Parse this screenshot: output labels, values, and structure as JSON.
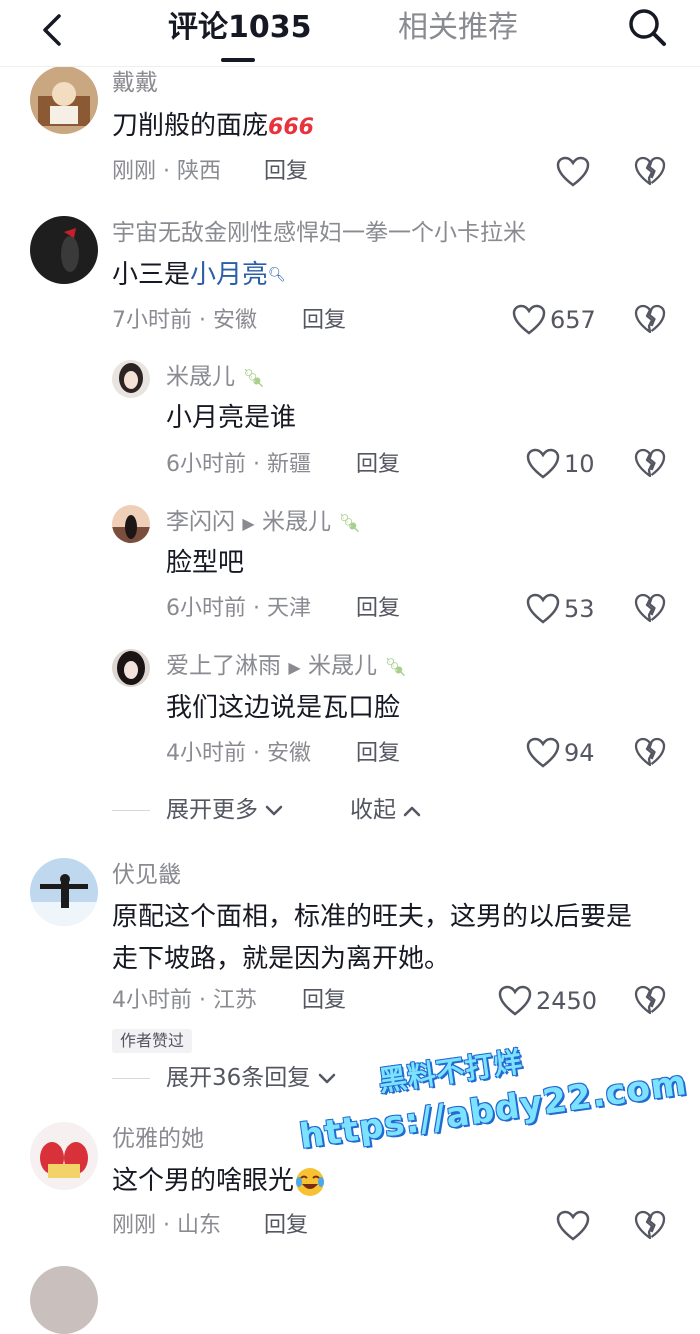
{
  "header": {
    "tab_comments": "评论1035",
    "tab_related": "相关推荐"
  },
  "comments": [
    {
      "username": "戴戴",
      "content": "刀削般的面庞",
      "emoji": "666",
      "time": "刚刚",
      "location": "陕西",
      "reply": "回复",
      "likes": ""
    },
    {
      "username": "宇宙无敌金刚性感悍妇一拳一个小卡拉米",
      "content_prefix": "小三是",
      "content_link": "小月亮",
      "time": "7小时前",
      "location": "安徽",
      "reply": "回复",
      "likes": "657"
    }
  ],
  "replies": [
    {
      "username": "米晟儿",
      "content": "小月亮是谁",
      "time": "6小时前",
      "location": "新疆",
      "reply": "回复",
      "likes": "10"
    },
    {
      "username": "李闪闪",
      "reply_to": "米晟儿",
      "content": "脸型吧",
      "time": "6小时前",
      "location": "天津",
      "reply": "回复",
      "likes": "53"
    },
    {
      "username": "爱上了淋雨",
      "reply_to": "米晟儿",
      "content": "我们这边说是瓦口脸",
      "time": "4小时前",
      "location": "安徽",
      "reply": "回复",
      "likes": "94"
    }
  ],
  "thread_controls": {
    "expand_more": "展开更多",
    "collapse": "收起"
  },
  "comment3": {
    "username": "伏见畿",
    "content_line1": "原配这个面相，标准的旺夫，这男的以后要是",
    "content_line2": "走下坡路，就是因为离开她。",
    "time": "4小时前",
    "location": "江苏",
    "reply": "回复",
    "likes": "2450",
    "badge": "作者赞过",
    "expand_replies": "展开36条回复"
  },
  "comment4": {
    "username": "优雅的她",
    "content": "这个男的啥眼光",
    "time": "刚刚",
    "location": "山东",
    "reply": "回复"
  },
  "watermark": {
    "line1": "黑料不打烊",
    "line2": "https://abdy22.com"
  }
}
